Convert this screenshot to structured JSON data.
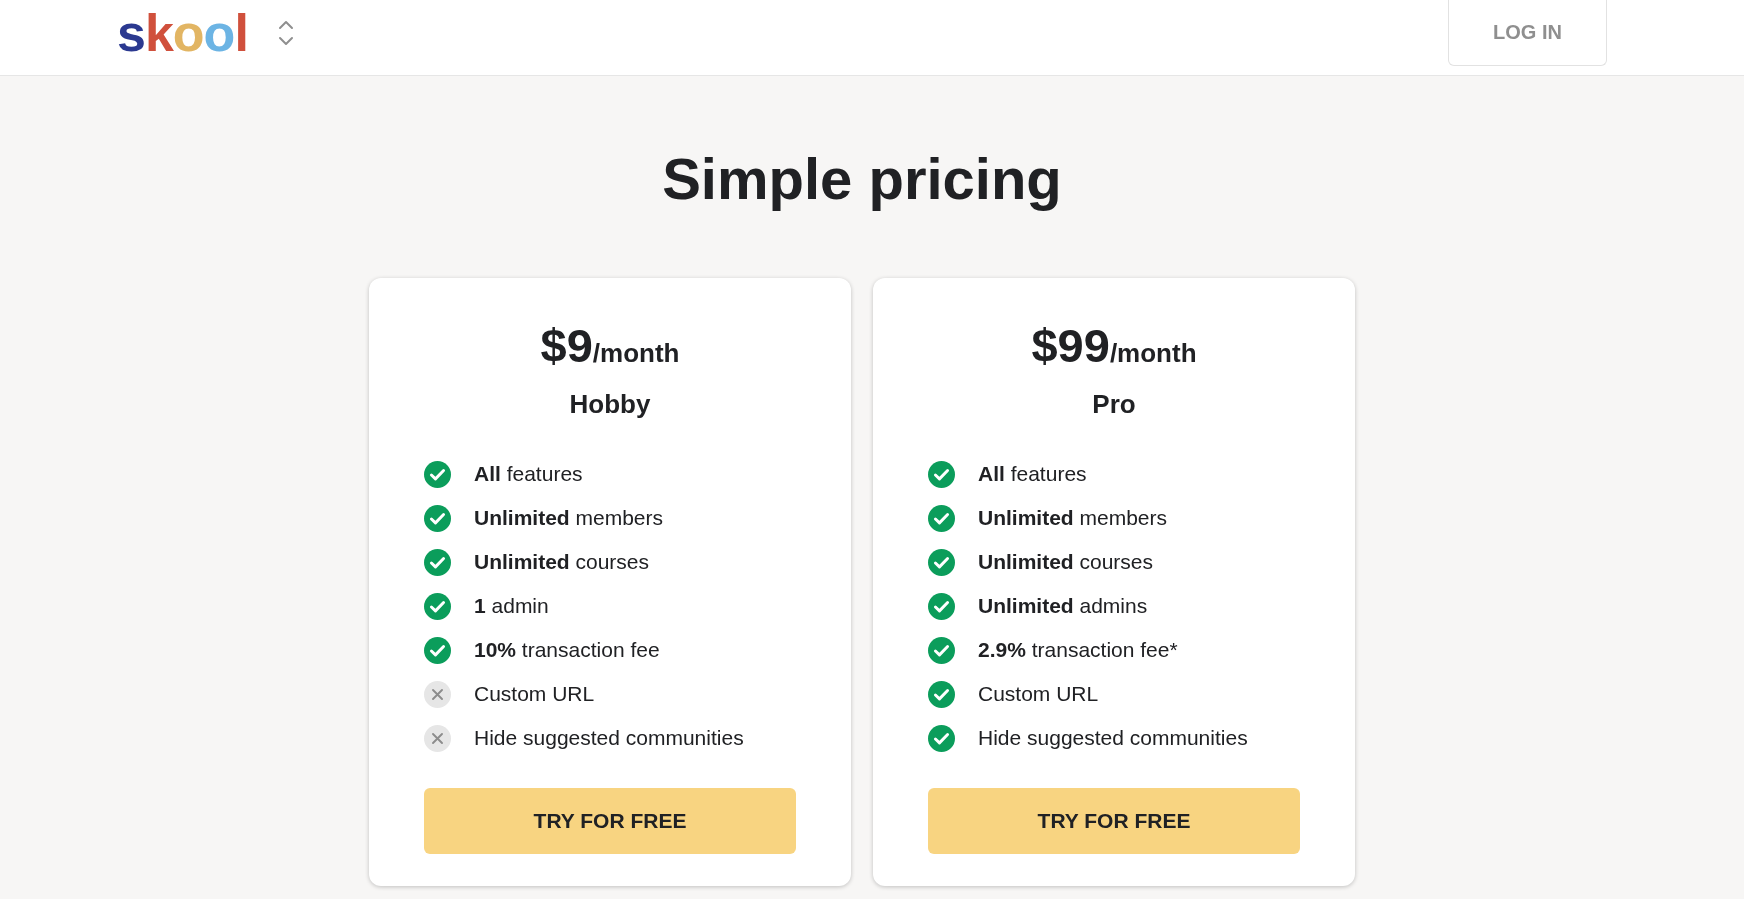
{
  "header": {
    "logo": "skool",
    "login_button": "LOG IN"
  },
  "title": "Simple pricing",
  "plans": [
    {
      "price": "$9",
      "period": "/month",
      "name": "Hobby",
      "features": [
        {
          "text": "**All** features",
          "included": true
        },
        {
          "text": "**Unlimited** members",
          "included": true
        },
        {
          "text": "**Unlimited** courses",
          "included": true
        },
        {
          "text": "**1** admin",
          "included": true
        },
        {
          "text": "**10%** transaction fee",
          "included": true
        },
        {
          "text": "Custom URL",
          "included": false
        },
        {
          "text": "Hide suggested communities",
          "included": false
        }
      ],
      "button": "TRY FOR FREE"
    },
    {
      "price": "$99",
      "period": "/month",
      "name": "Pro",
      "features": [
        {
          "text": "**All** features",
          "included": true
        },
        {
          "text": "**Unlimited** members",
          "included": true
        },
        {
          "text": "**Unlimited** courses",
          "included": true
        },
        {
          "text": "**Unlimited** admins",
          "included": true
        },
        {
          "text": "**2.9%** transaction fee*",
          "included": true
        },
        {
          "text": "Custom URL",
          "included": true
        },
        {
          "text": "Hide suggested communities",
          "included": true
        }
      ],
      "button": "TRY FOR FREE"
    }
  ]
}
